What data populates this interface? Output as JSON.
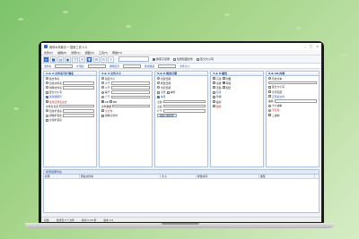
{
  "window": {
    "title": "雨林木风助手 • 搜索工具 5.0"
  },
  "menu": [
    "文件(F)",
    "编辑(E)",
    "搜索(S)",
    "视图(V)",
    "工具(T)",
    "帮助(H)"
  ],
  "toolbar": {
    "checkbox_labels": [
      "搜索子目录",
      "包含隐藏文件",
      "区分大小写"
    ]
  },
  "filterbar": {
    "labels": [
      "文件名",
      "扩展名",
      "排除目录",
      "搜索路径",
      "文件大小"
    ]
  },
  "panels": [
    {
      "title": "1.& 2.文件名与扩展名",
      "rows": [
        "按文件名",
        "包含文件名",
        "排除文件名",
        "区分大小写",
        "使用通配符",
        "使用正则表达式",
        "文件名长度",
        "包含扩展名",
        "排除扩展名",
        "全部扩展名"
      ]
    },
    {
      "title": "3.& 4.文件大小",
      "rows": [
        "指定大小",
        "大于",
        "小于",
        "等于",
        "介于",
        "KB",
        "MB",
        "文件数量",
        "空文件",
        "排除空文件"
      ]
    },
    {
      "title": "5.& 6.修改日期",
      "rows": [
        "创建日期",
        "修改日期",
        "访问日期",
        "今天",
        "本周",
        "本月",
        "之前",
        "之后",
        "介于",
        "指定日期范围"
      ]
    },
    {
      "title": "7.& 8.属性",
      "rows": [
        "只读",
        "隐藏",
        "系统",
        "存档",
        "压缩",
        "加密",
        "目录",
        "普通",
        "临时",
        "脱机"
      ]
    },
    {
      "title": "9.& 10.内容",
      "rows": [
        "包含文本",
        "区分大小写",
        "全字匹配",
        "正则表达式",
        "编码",
        "十六进制",
        "不包含",
        "二进制",
        "Unicode",
        "UTF-8"
      ]
    }
  ],
  "results": {
    "header": "搜索结果列表",
    "columns": [
      "名称",
      "所在文件夹",
      "大小",
      "修改时间",
      "类型"
    ]
  },
  "status": {
    "items": [
      "就绪",
      "共找到 0 个文件",
      "耗时 0.00 秒",
      "版本 5.0"
    ]
  }
}
